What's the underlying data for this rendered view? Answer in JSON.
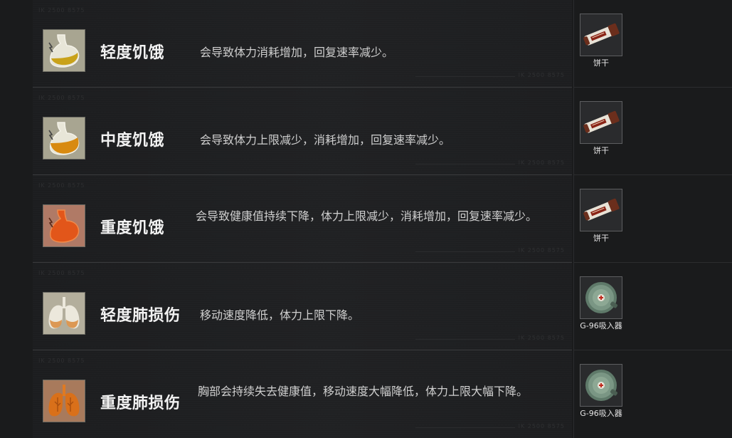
{
  "conditions": [
    {
      "name": "轻度饥饿",
      "description": "会导致体力消耗增加，回复速率减少。",
      "icon": "stomach-mild-hunger-icon",
      "icon_color": "#c9a21a",
      "item": {
        "label": "饼干",
        "icon": "biscuit-icon"
      }
    },
    {
      "name": "中度饥饿",
      "description": "会导致体力上限减少，消耗增加，回复速率减少。",
      "icon": "stomach-moderate-hunger-icon",
      "icon_color": "#d88a10",
      "item": {
        "label": "饼干",
        "icon": "biscuit-icon"
      }
    },
    {
      "name": "重度饥饿",
      "description": "会导致健康值持续下降，体力上限减少，消耗增加，回复速率减少。",
      "icon": "stomach-severe-hunger-icon",
      "icon_color": "#e2561a",
      "item": {
        "label": "饼干",
        "icon": "biscuit-icon"
      }
    },
    {
      "name": "轻度肺损伤",
      "description": "移动速度降低，体力上限下降。",
      "icon": "lungs-mild-damage-icon",
      "icon_color": "#d98a3c",
      "item": {
        "label": "G-96吸入器",
        "icon": "inhaler-icon"
      }
    },
    {
      "name": "重度肺损伤",
      "description": "胸部会持续失去健康值，移动速度大幅降低，体力上限大幅下降。",
      "icon": "lungs-severe-damage-icon",
      "icon_color": "#d9701a",
      "item": {
        "label": "G-96吸入器",
        "icon": "inhaler-icon"
      }
    }
  ]
}
